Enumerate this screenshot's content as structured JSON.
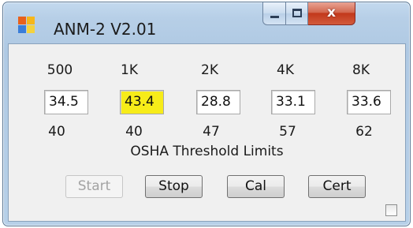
{
  "window": {
    "title": "ANM-2 V2.01",
    "close_glyph": "x"
  },
  "frequencies": [
    "500",
    "1K",
    "2K",
    "4K",
    "8K"
  ],
  "values": [
    {
      "value": "34.5",
      "highlighted": false
    },
    {
      "value": "43.4",
      "highlighted": true
    },
    {
      "value": "28.8",
      "highlighted": false
    },
    {
      "value": "33.1",
      "highlighted": false
    },
    {
      "value": "33.6",
      "highlighted": false
    }
  ],
  "limits": [
    "40",
    "40",
    "47",
    "57",
    "62"
  ],
  "threshold_label": "OSHA Threshold Limits",
  "buttons": {
    "start": "Start",
    "stop": "Stop",
    "cal": "Cal",
    "cert": "Cert"
  },
  "colors": {
    "highlight": "#f7ec19",
    "disabled_text": "#a3a3a3"
  },
  "icons": {
    "app": "app-logo-icon",
    "minimize": "minimize-icon",
    "maximize": "maximize-icon",
    "close": "close-icon"
  }
}
